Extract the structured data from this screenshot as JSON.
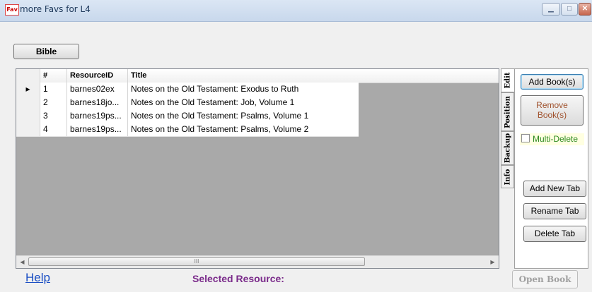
{
  "window": {
    "title": "more Favs for L4",
    "icon_text": "Fav"
  },
  "tab_button": {
    "label": "Bible"
  },
  "grid": {
    "columns": [
      "",
      "#",
      "ResourceID",
      "Title"
    ],
    "rows": [
      {
        "marker": "▸",
        "num": "1",
        "resource_id": "barnes02ex",
        "title": "Notes on the Old Testament: Exodus to Ruth"
      },
      {
        "marker": "",
        "num": "2",
        "resource_id": "barnes18jo...",
        "title": "Notes on the Old Testament: Job, Volume 1"
      },
      {
        "marker": "",
        "num": "3",
        "resource_id": "barnes19ps...",
        "title": "Notes on the Old Testament: Psalms, Volume 1"
      },
      {
        "marker": "",
        "num": "4",
        "resource_id": "barnes19ps...",
        "title": "Notes on the Old Testament: Psalms, Volume 2"
      }
    ],
    "scroll_thumb_grip": "III"
  },
  "side_tabs": [
    "Edit",
    "Position",
    "Backup",
    "Info"
  ],
  "panel": {
    "add_books": "Add Book(s)",
    "remove_books_line1": "Remove",
    "remove_books_line2": "Book(s)",
    "multi_delete": "Multi-Delete",
    "add_new_tab": "Add New Tab",
    "rename_tab": "Rename Tab",
    "delete_tab": "Delete Tab"
  },
  "footer": {
    "help": "Help",
    "selected_resource": "Selected Resource:",
    "open_book": "Open Book"
  },
  "colors": {
    "help_link": "#1b4fc4",
    "selected_resource": "#7a2a8a",
    "remove_button_text": "#a0522d",
    "multi_delete_text": "#2e8b20"
  }
}
